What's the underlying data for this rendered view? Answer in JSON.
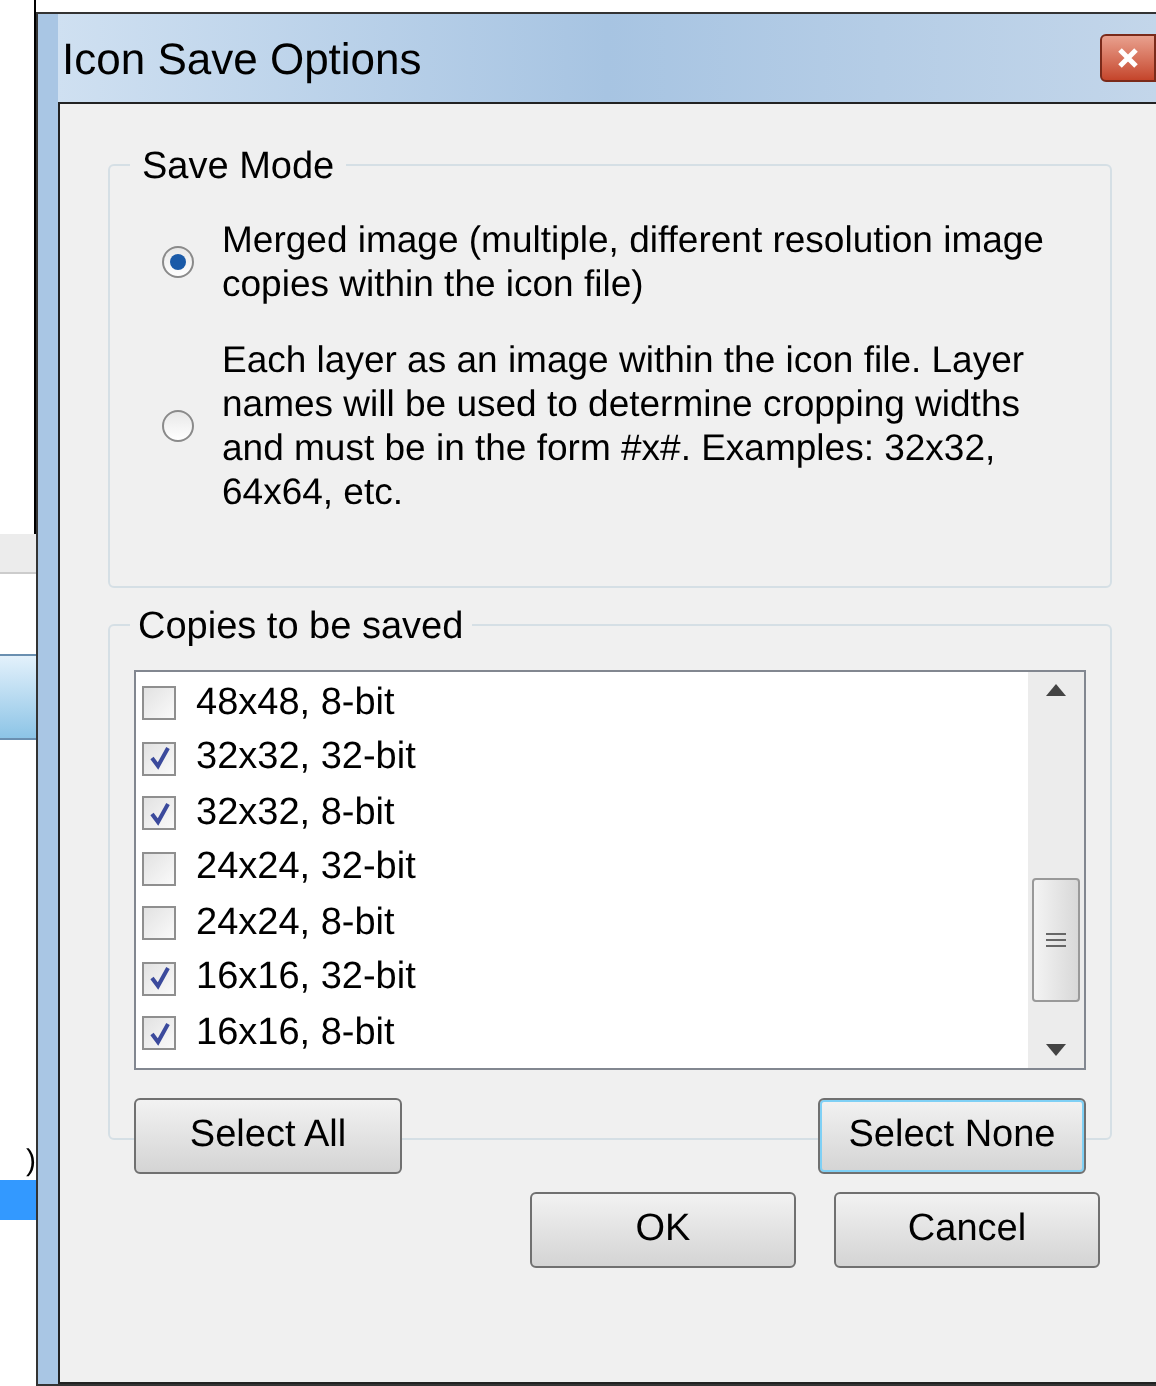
{
  "background_window": {
    "text": ")"
  },
  "window": {
    "title": "Icon Save Options"
  },
  "save_mode": {
    "title": "Save Mode",
    "options": [
      {
        "label": "Merged image (multiple, different resolution image copies within the icon file)",
        "selected": true
      },
      {
        "label": "Each layer as an image within the icon file. Layer names will be used to determine cropping widths and must be in the form #x#. Examples: 32x32, 64x64, etc.",
        "selected": false
      }
    ]
  },
  "copies": {
    "title": "Copies to be saved",
    "items": [
      {
        "label": "48x48, 8-bit",
        "checked": false
      },
      {
        "label": "32x32, 32-bit",
        "checked": true
      },
      {
        "label": "32x32, 8-bit",
        "checked": true
      },
      {
        "label": "24x24, 32-bit",
        "checked": false
      },
      {
        "label": "24x24, 8-bit",
        "checked": false
      },
      {
        "label": "16x16, 32-bit",
        "checked": true
      },
      {
        "label": "16x16, 8-bit",
        "checked": true
      }
    ],
    "buttons": [
      {
        "label": "Select All",
        "focused": false
      },
      {
        "label": "Select None",
        "focused": true
      }
    ]
  },
  "buttons": [
    "OK",
    "Cancel"
  ]
}
